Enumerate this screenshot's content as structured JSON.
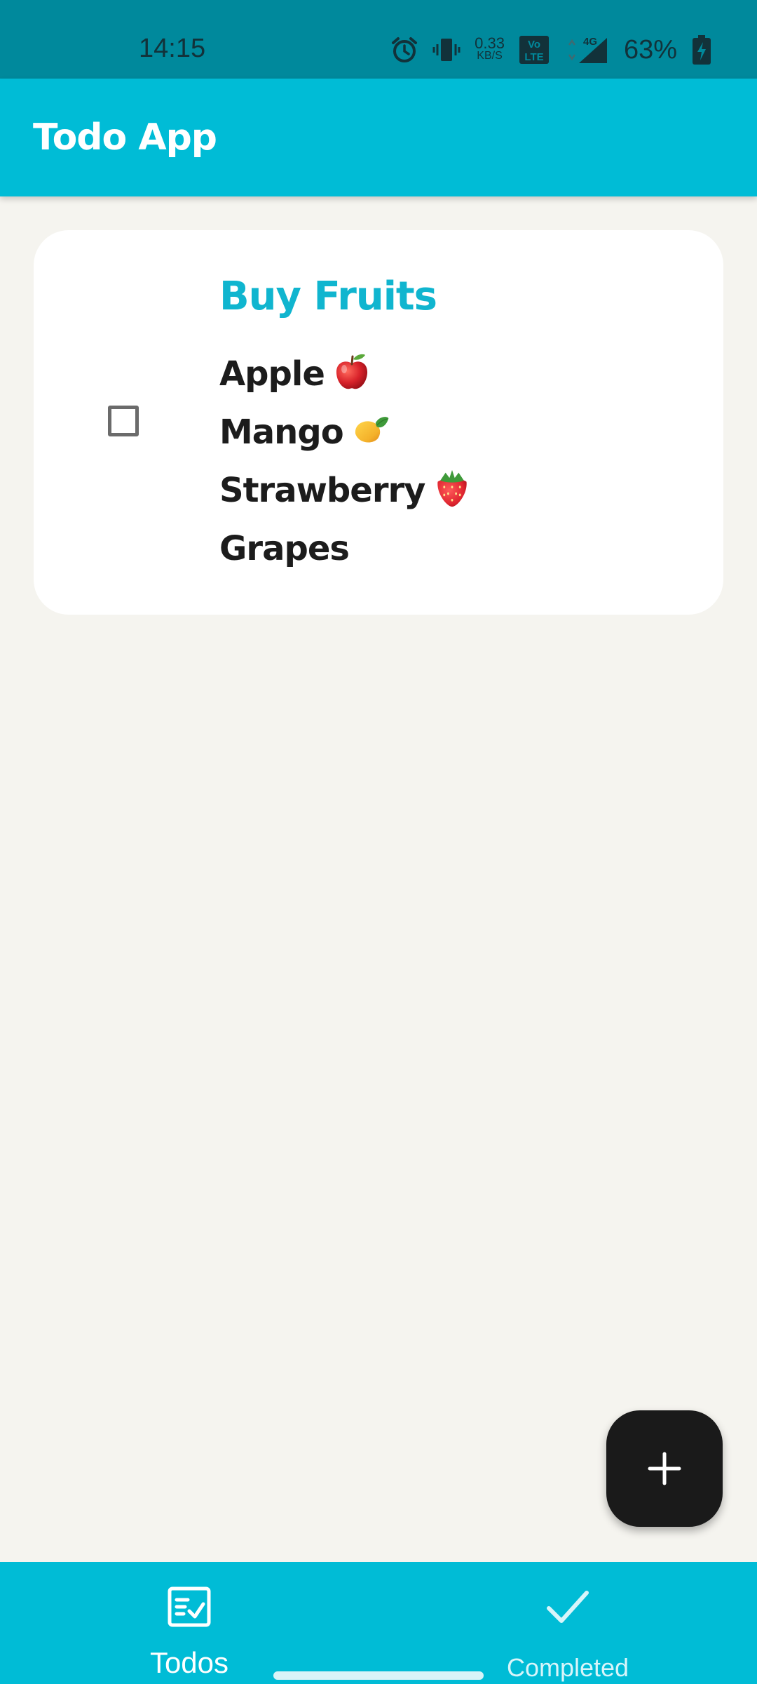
{
  "status_bar": {
    "time": "14:15",
    "speed_value": "0.33",
    "speed_unit": "KB/S",
    "volte_top": "Vo",
    "volte_bottom": "LTE",
    "network": "4G",
    "battery": "63%",
    "icons": [
      "alarm-icon",
      "vibrate-icon",
      "volte-icon",
      "signal-icon",
      "battery-charging-icon"
    ]
  },
  "app_bar": {
    "title": "Todo App"
  },
  "todos": [
    {
      "title": "Buy Fruits",
      "checked": false,
      "lines": [
        "Apple",
        "Mango",
        "Strawberry",
        "Grapes"
      ],
      "line_emoji": [
        "apple-emoji",
        "mango-emoji",
        "strawberry-emoji",
        null
      ]
    }
  ],
  "fab": {
    "icon": "plus-icon"
  },
  "bottom_nav": {
    "items": [
      {
        "label": "Todos",
        "icon": "checklist-icon",
        "active": true
      },
      {
        "label": "Completed",
        "icon": "check-icon",
        "active": false
      }
    ]
  },
  "colors": {
    "status_bar": "#00899c",
    "app_bar": "#00bcd6",
    "accent_title": "#10b5cf",
    "background": "#f5f4ef",
    "fab": "#1a1a1a"
  }
}
